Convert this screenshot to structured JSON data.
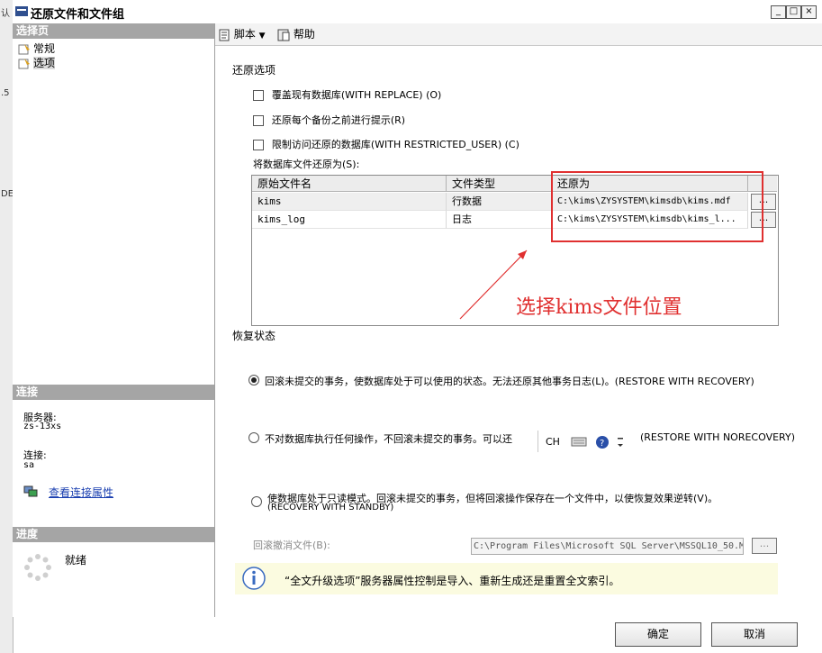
{
  "window": {
    "title": "还原文件和文件组",
    "controls": [
      "_",
      "□",
      "×"
    ]
  },
  "desk_fragments": [
    "认",
    ".5",
    "DE"
  ],
  "left_pane": {
    "select_page_header": "选择页",
    "pages": [
      {
        "label": "常规",
        "icon": "page-icon"
      },
      {
        "label": "选项",
        "icon": "page-icon"
      }
    ],
    "connection_header": "连接",
    "server_label": "服务器:",
    "server_value": "zs-13xs",
    "connection_label": "连接:",
    "connection_value": "sa",
    "view_props_link": "查看连接属性",
    "progress_header": "进度",
    "progress_status": "就绪"
  },
  "toolbar": {
    "script_label": "脚本",
    "help_label": "帮助"
  },
  "restore_options": {
    "group_label": "还原选项",
    "options": [
      {
        "label": "覆盖现有数据库(WITH REPLACE) (O)",
        "checked": false
      },
      {
        "label": "还原每个备份之前进行提示(R)",
        "checked": false
      },
      {
        "label": "限制访问还原的数据库(WITH RESTRICTED_USER) (C)",
        "checked": false
      }
    ],
    "restore_files_as_label": "将数据库文件还原为(S):"
  },
  "file_grid": {
    "columns": [
      "原始文件名",
      "文件类型",
      "还原为"
    ],
    "rows": [
      {
        "original": "kims",
        "type": "行数据",
        "restore_as": "C:\\kims\\ZYSYSTEM\\kimsdb\\kims.mdf",
        "button": "..."
      },
      {
        "original": "kims_log",
        "type": "日志",
        "restore_as": "C:\\kims\\ZYSYSTEM\\kimsdb\\kims_l...",
        "button": "..."
      }
    ]
  },
  "annotation": {
    "text": "选择kims文件位置",
    "color": "#e03030"
  },
  "recovery_state": {
    "group_label": "恢复状态",
    "options": [
      {
        "label": "回滚未提交的事务，使数据库处于可以使用的状态。无法还原其他事务日志(L)。(RESTORE WITH RECOVERY)",
        "selected": true
      },
      {
        "label": "不对数据库执行任何操作，不回滚未提交的事务。可以还",
        "label_tail": "(RESTORE WITH NORECOVERY)",
        "selected": false
      },
      {
        "label": "使数据库处于只读模式。回滚未提交的事务，但将回滚操作保存在一个文件中，以使恢复效果逆转(V)。",
        "label_line2": "(RECOVERY WITH STANDBY)",
        "selected": false
      }
    ],
    "undo_file_label": "回滚撤消文件(B):",
    "undo_file_value": "C:\\Program Files\\Microsoft SQL Server\\MSSQL10_50.M",
    "undo_file_button": "..."
  },
  "ime_bar": {
    "lang": "CH",
    "items": [
      "keyboard-icon",
      "help-icon",
      "options-icon"
    ]
  },
  "info_bar": {
    "text": "“全文升级选项”服务器属性控制是导入、重新生成还是重置全文索引。"
  },
  "buttons": {
    "ok": "确定",
    "cancel": "取消"
  },
  "colors": {
    "section_header": "#a5a5a5",
    "highlight_box": "#e03030",
    "info_bg": "#fbfbe0",
    "link": "#1a3fb0"
  }
}
